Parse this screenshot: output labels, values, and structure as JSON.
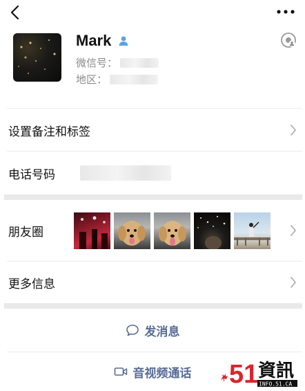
{
  "profile": {
    "name": "Mark",
    "wechat_id_label": "微信号：",
    "region_label": "地区："
  },
  "rows": {
    "remark_label": "设置备注和标签",
    "phone_label": "电话号码",
    "moments_label": "朋友圈",
    "more_info_label": "更多信息"
  },
  "actions": {
    "message_label": "发消息",
    "call_label": "音视频通话"
  },
  "watermark": {
    "brand": "51",
    "brand_text": "資訊",
    "site": "INFO.51.CA"
  },
  "colors": {
    "link": "#576b95",
    "muted": "#8a8a8a",
    "separator": "#ececec"
  }
}
